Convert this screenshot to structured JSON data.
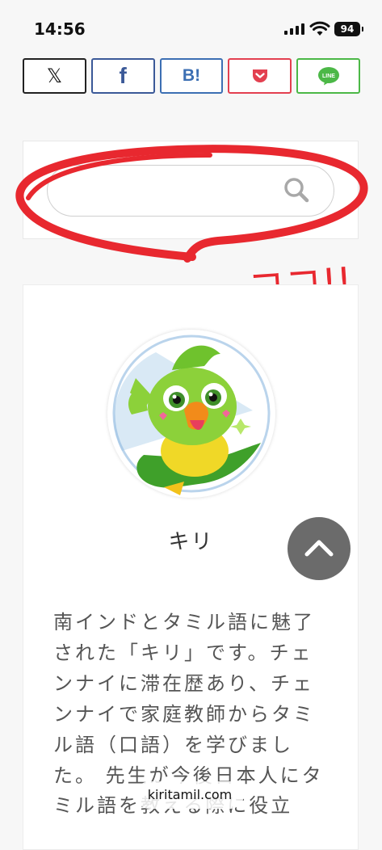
{
  "status_bar": {
    "time": "14:56",
    "battery": "94"
  },
  "share_buttons": [
    {
      "label": "𝕏"
    },
    {
      "label": "f"
    },
    {
      "label": "B!"
    },
    {
      "label": ""
    },
    {
      "label": "LINE"
    }
  ],
  "search": {
    "value": "",
    "placeholder": ""
  },
  "annotation": {
    "text": "ココ!!"
  },
  "profile": {
    "name": "キリ",
    "bio": "南インドとタミル語に魅了された「キリ」です。チェンナイに滞在歴あり、チェンナイで家庭教師からタミル語（口語）を学びました。 先生が今後日本人にタミル語を教える際に役立"
  },
  "browser": {
    "url": "kiritamil.com"
  },
  "colors": {
    "annotation_red": "#e8282f",
    "facebook": "#3b5998",
    "hatena": "#3c6fb3",
    "pocket": "#e34050",
    "line": "#4cb847"
  }
}
